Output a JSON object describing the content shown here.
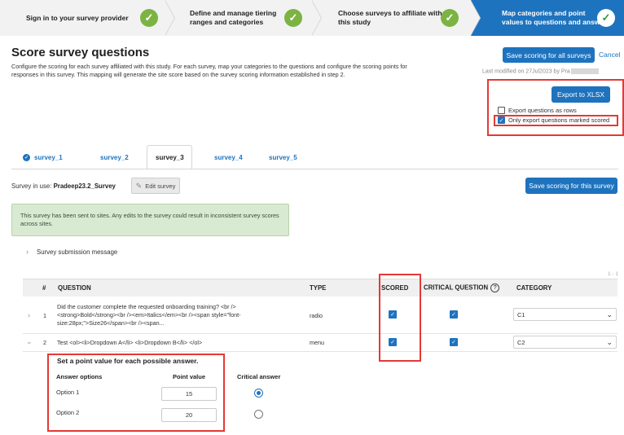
{
  "wizard": {
    "steps": [
      {
        "label_line1": "Sign in to your survey provider",
        "label_line2": ""
      },
      {
        "label_line1": "Define and manage tiering",
        "label_line2": "ranges and categories"
      },
      {
        "label_line1": "Choose surveys to affiliate with",
        "label_line2": "this study"
      },
      {
        "label_line1": "Map categories and point",
        "label_line2": "values to questions and answers"
      }
    ],
    "check": "✓"
  },
  "header": {
    "title": "Score survey questions",
    "intro": "Configure the scoring for each survey affiliated with this study. For each survey, map your categories to the questions and configure the scoring points for responses in this survey. This mapping will generate the site score based on the survey scoring information established in step 2.",
    "save_all_label": "Save scoring for all surveys",
    "cancel_label": "Cancel",
    "last_modified": "Last modified on 27Jul2023 by Pra"
  },
  "export": {
    "button_label": "Export to XLSX",
    "rows_label": "Export questions as rows",
    "rows_checked": false,
    "scored_label": "Only export questions marked scored",
    "scored_checked": true
  },
  "tabs": [
    {
      "label": "survey_1",
      "done": true
    },
    {
      "label": "survey_2",
      "done": false
    },
    {
      "label": "survey_3",
      "done": false,
      "active": true
    },
    {
      "label": "survey_4",
      "done": false
    },
    {
      "label": "survey_5",
      "done": false
    }
  ],
  "survey": {
    "in_use_prefix": "Survey in use:",
    "in_use_name": "Pradeep23.2_Survey",
    "edit_label": "Edit survey",
    "save_label": "Save scoring for this survey",
    "alert": "This survey has been sent to sites. Any edits to the survey could result in inconsistent survey scores across sites.",
    "submission_label": "Survey submission message",
    "pager": "1 - 1"
  },
  "table": {
    "headers": {
      "num": "#",
      "question": "QUESTION",
      "type": "TYPE",
      "scored": "SCORED",
      "critical": "CRITICAL QUESTION",
      "category": "CATEGORY",
      "help": "?"
    },
    "rows": [
      {
        "num": "1",
        "question_l1": "Did the customer complete the requested onboarding training? <br />",
        "question_l2": "<strong>Bold</strong><br /><em>Italics</em><br /><span style=\"font-",
        "question_l3": "size:28px;\">Size26</span><br /><span...",
        "type": "radio",
        "scored": true,
        "critical": true,
        "category": "C1"
      },
      {
        "num": "2",
        "question_l1": "Test <ol><li>Dropdown A</li> <li>Dropdown B</li> </ol>",
        "type": "menu",
        "scored": true,
        "critical": true,
        "category": "C2"
      }
    ]
  },
  "detail": {
    "title": "Set a point value for each possible answer.",
    "col_options": "Answer options",
    "col_points": "Point value",
    "col_critical": "Critical answer",
    "options": [
      {
        "label": "Option 1",
        "points": "15",
        "critical": true
      },
      {
        "label": "Option 2",
        "points": "20",
        "critical": false
      }
    ]
  },
  "colors": {
    "accent": "#1e73be",
    "success": "#7cb342",
    "highlight": "#e53935"
  }
}
